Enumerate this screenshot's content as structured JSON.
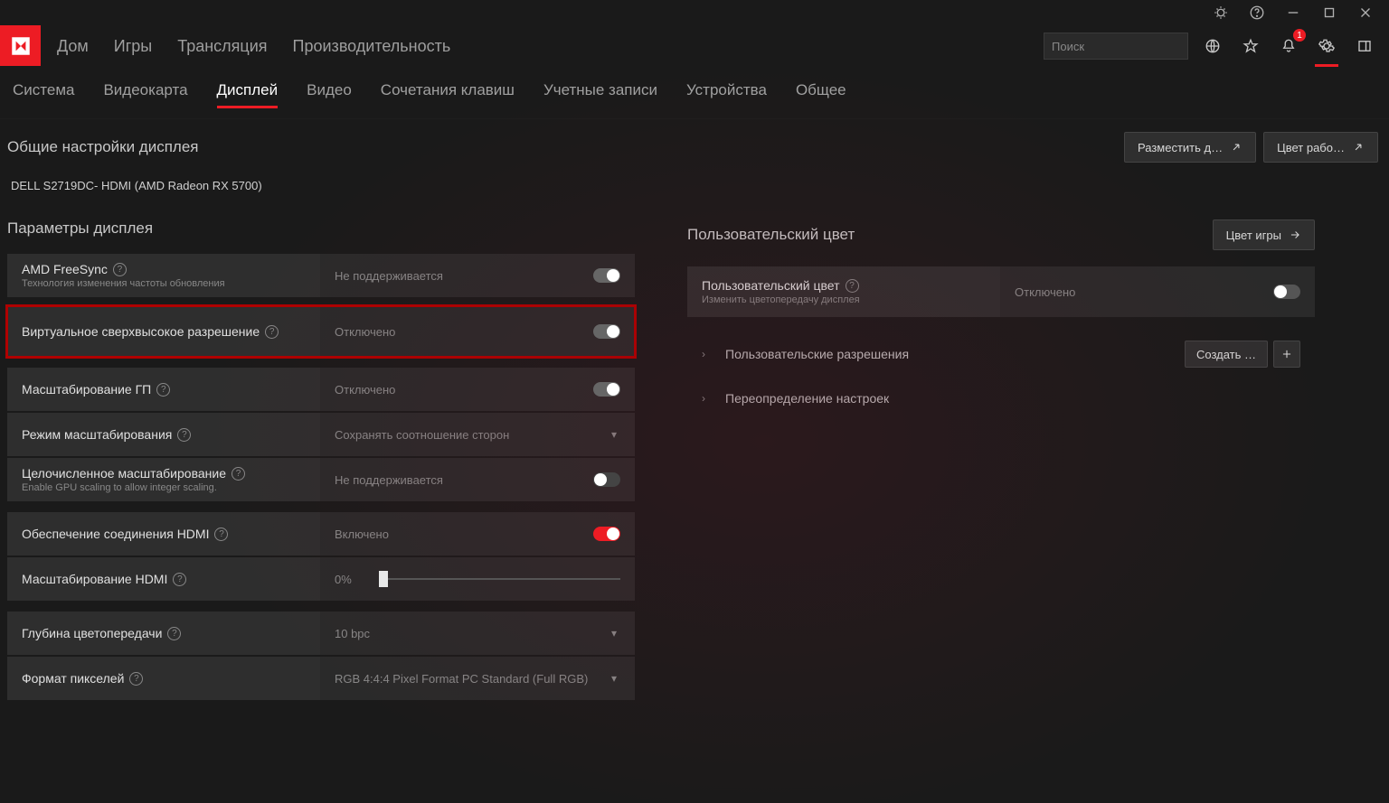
{
  "titlebar": {
    "buttons": [
      "bug",
      "help",
      "minimize",
      "maximize",
      "close"
    ]
  },
  "nav_main": {
    "items": [
      "Дом",
      "Игры",
      "Трансляция",
      "Производительность"
    ]
  },
  "search": {
    "placeholder": "Поиск"
  },
  "notification_badge": "1",
  "subtabs": {
    "items": [
      "Система",
      "Видеокарта",
      "Дисплей",
      "Видео",
      "Сочетания клавиш",
      "Учетные записи",
      "Устройства",
      "Общее"
    ],
    "active_index": 2
  },
  "page_title": "Общие настройки дисплея",
  "top_buttons": {
    "arrange": "Разместить д…",
    "desktop_color": "Цвет рабо…"
  },
  "device": "DELL S2719DC- HDMI (AMD Radeon RX 5700)",
  "left_col": {
    "title": "Параметры дисплея",
    "rows": [
      {
        "id": "freesync",
        "label": "AMD FreeSync",
        "sub": "Технология изменения частоты обновления",
        "value": "Не поддерживается",
        "control": "toggle-ongrey"
      },
      {
        "id": "vsr",
        "label": "Виртуальное сверхвысокое разрешение",
        "sub": "",
        "value": "Отключено",
        "control": "toggle-ongrey",
        "highlight": true
      },
      {
        "id": "gpuscale",
        "label": "Масштабирование ГП",
        "sub": "",
        "value": "Отключено",
        "control": "toggle-ongrey",
        "gap_before": true
      },
      {
        "id": "scalemode",
        "label": "Режим масштабирования",
        "sub": "",
        "value": "Сохранять соотношение сторон",
        "control": "dropdown"
      },
      {
        "id": "intscale",
        "label": "Целочисленное масштабирование",
        "sub": "Enable GPU scaling to allow integer scaling.",
        "value": "Не поддерживается",
        "control": "toggle-disabled"
      },
      {
        "id": "hdmilink",
        "label": "Обеспечение соединения HDMI",
        "sub": "",
        "value": "Включено",
        "control": "toggle-on",
        "gap_before": true
      },
      {
        "id": "hdmiscale",
        "label": "Масштабирование HDMI",
        "sub": "",
        "value": "0%",
        "control": "slider"
      },
      {
        "id": "colordepth",
        "label": "Глубина цветопередачи",
        "sub": "",
        "value": "10 bpc",
        "control": "dropdown",
        "gap_before": true
      },
      {
        "id": "pixelformat",
        "label": "Формат пикселей",
        "sub": "",
        "value": "RGB 4:4:4 Pixel Format PC Standard (Full RGB)",
        "control": "dropdown"
      }
    ]
  },
  "right_col": {
    "title": "Пользовательский цвет",
    "game_color_btn": "Цвет игры",
    "user_color_row": {
      "label": "Пользовательский цвет",
      "sub": "Изменить цветопередачу дисплея",
      "value": "Отключено"
    },
    "custom_res": {
      "label": "Пользовательские разрешения",
      "create_btn": "Создать …"
    },
    "override": {
      "label": "Переопределение настроек"
    }
  }
}
